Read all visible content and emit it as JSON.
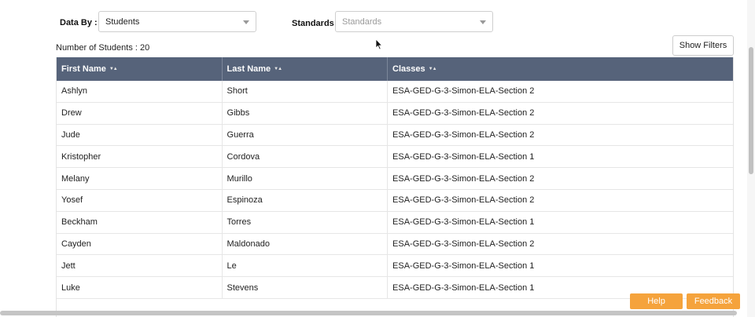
{
  "filters": {
    "data_by_label": "Data By :",
    "data_by_value": "Students",
    "standards_label": "Standards",
    "standards_placeholder": "Standards"
  },
  "summary": {
    "count_text": "Number of Students : 20"
  },
  "toolbar": {
    "show_filters_label": "Show Filters"
  },
  "table": {
    "columns": [
      "First Name",
      "Last Name",
      "Classes"
    ],
    "sort_glyph": "▼▲",
    "rows": [
      [
        "Ashlyn",
        "Short",
        "ESA-GED-G-3-Simon-ELA-Section 2"
      ],
      [
        "Drew",
        "Gibbs",
        "ESA-GED-G-3-Simon-ELA-Section 2"
      ],
      [
        "Jude",
        "Guerra",
        "ESA-GED-G-3-Simon-ELA-Section 2"
      ],
      [
        "Kristopher",
        "Cordova",
        "ESA-GED-G-3-Simon-ELA-Section 1"
      ],
      [
        "Melany",
        "Murillo",
        "ESA-GED-G-3-Simon-ELA-Section 2"
      ],
      [
        "Yosef",
        "Espinoza",
        "ESA-GED-G-3-Simon-ELA-Section 2"
      ],
      [
        "Beckham",
        "Torres",
        "ESA-GED-G-3-Simon-ELA-Section 1"
      ],
      [
        "Cayden",
        "Maldonado",
        "ESA-GED-G-3-Simon-ELA-Section 2"
      ],
      [
        "Jett",
        "Le",
        "ESA-GED-G-3-Simon-ELA-Section 1"
      ],
      [
        "Luke",
        "Stevens",
        "ESA-GED-G-3-Simon-ELA-Section 1"
      ]
    ]
  },
  "footer": {
    "help_label": "Help",
    "feedback_label": "Feedback"
  },
  "colors": {
    "table_header": "#56637a",
    "accent_button": "#f5a33c"
  }
}
